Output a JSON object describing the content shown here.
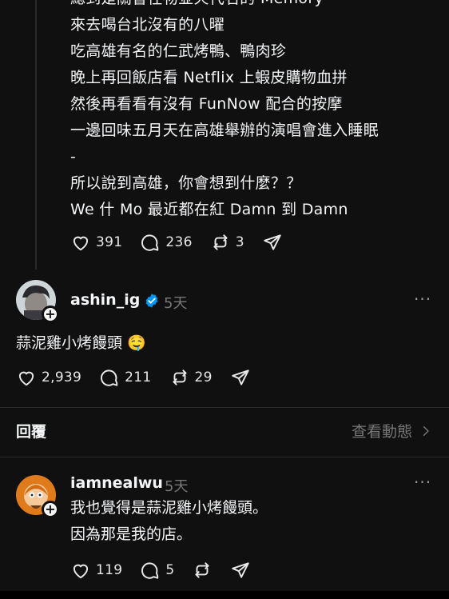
{
  "post": {
    "lines": [
      "總到是關督任物並火代名的 Memory",
      "來去喝台北沒有的八曜",
      "吃高雄有名的仁武烤鴨、鴨肉珍",
      "晚上再回飯店看 Netflix 上蝦皮購物血拼",
      "然後再看看有沒有 FunNow 配合的按摩",
      "一邊回味五月天在高雄舉辦的演唱會進入睡眠",
      "-",
      "所以說到高雄，你會想到什麼？？",
      "We 什 Mo 最近都在紅 Damn 到 Damn"
    ],
    "likes": "391",
    "comments": "236",
    "reposts": "3"
  },
  "comment1": {
    "username": "ashin_ig",
    "time": "5天",
    "text": "蒜泥雞小烤饅頭 🤤",
    "likes": "2,939",
    "comments": "211",
    "reposts": "29",
    "more": "···"
  },
  "replies_section": {
    "label": "回覆",
    "view_activity": "查看動態"
  },
  "comment2": {
    "username": "iamnealwu",
    "time": "5天",
    "lines": [
      "我也覺得是蒜泥雞小烤饅頭。",
      "因為那是我的店。"
    ],
    "likes": "119",
    "comments": "5",
    "more": "···"
  },
  "icons": {
    "heart": "heart-icon",
    "comment": "comment-icon",
    "repost": "repost-icon",
    "share": "share-icon",
    "verified": "verified-badge-icon",
    "chevron": "chevron-right-icon"
  },
  "colors": {
    "background": "#101010",
    "verified": "#0095f6",
    "muted": "#777777"
  }
}
